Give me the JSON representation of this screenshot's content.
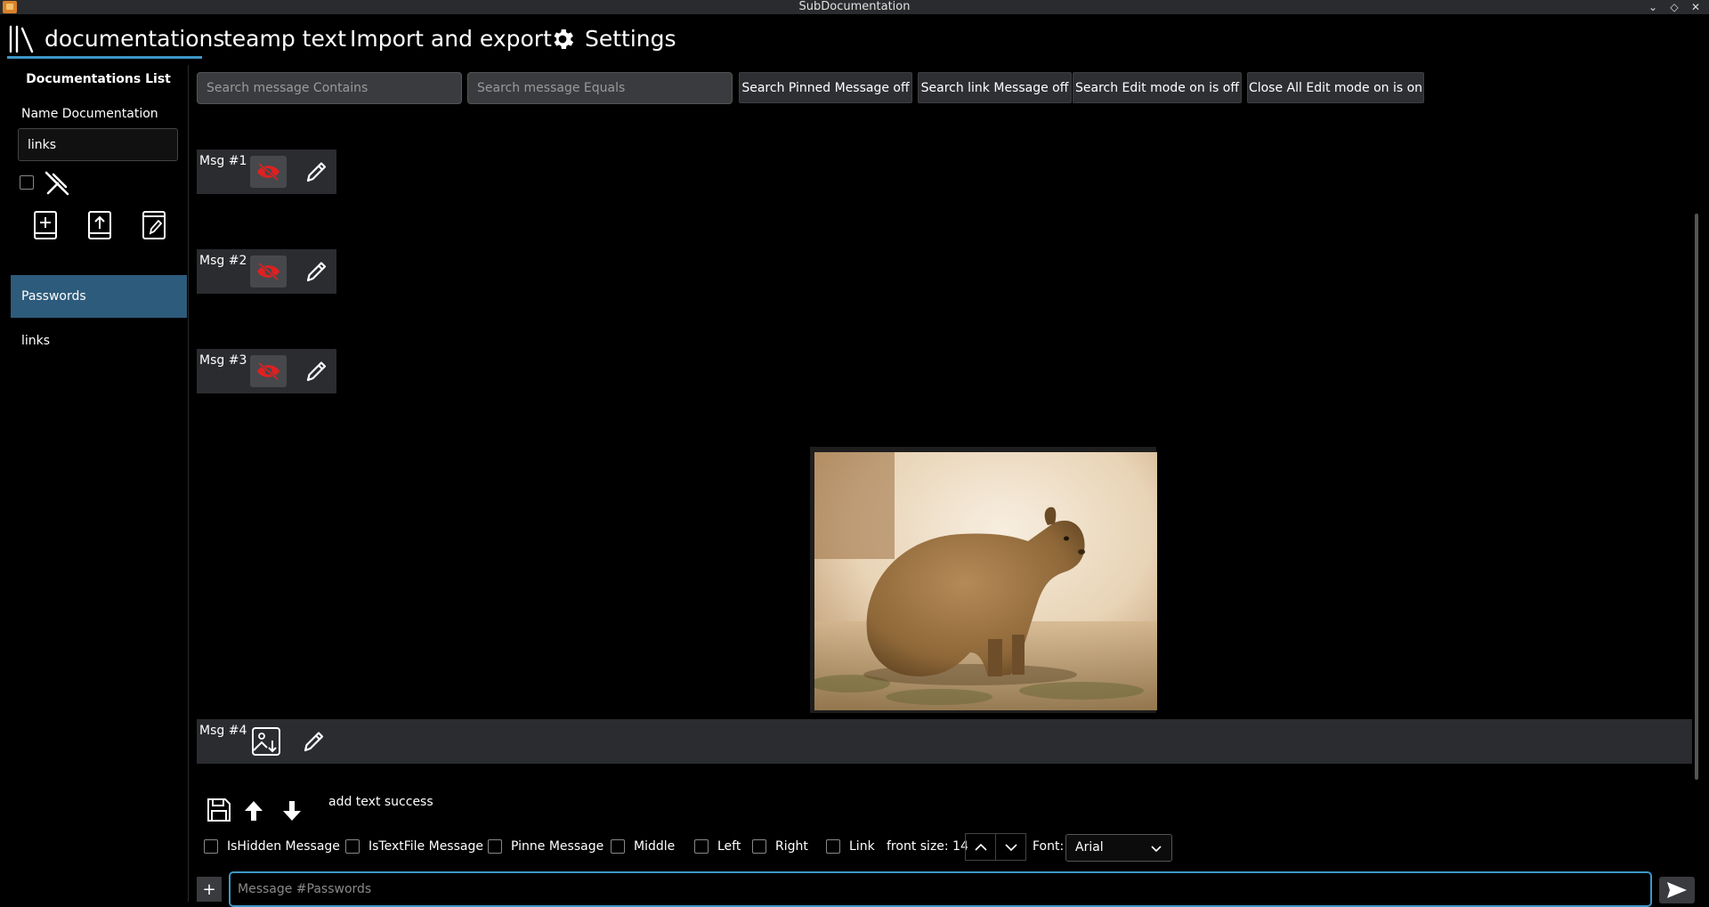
{
  "window": {
    "title": "SubDocumentation"
  },
  "nav": {
    "tabs": [
      {
        "label": "documentations"
      },
      {
        "label": "teamp text"
      },
      {
        "label": "Import and export"
      },
      {
        "label": "Settings"
      }
    ]
  },
  "sidebar": {
    "title": "Documentations List",
    "name_label": "Name Documentation",
    "name_value": "links",
    "items": [
      {
        "label": "Passwords",
        "selected": true
      },
      {
        "label": "links",
        "selected": false
      }
    ]
  },
  "search": {
    "contains_placeholder": "Search message Contains",
    "equals_placeholder": "Search message Equals",
    "pinned_label": "Search Pinned Message off",
    "link_label": "Search link Message off",
    "edit_mode_label": "Search Edit mode on is off",
    "close_all_label": "Close All Edit mode on is on"
  },
  "messages": [
    {
      "label": "Msg #1"
    },
    {
      "label": "Msg #2"
    },
    {
      "label": "Msg #3"
    },
    {
      "label": "Msg #4"
    }
  ],
  "toolbar": {
    "status": "add text success",
    "options": [
      {
        "label": "IsHidden Message",
        "checked": false
      },
      {
        "label": "IsTextFile Message",
        "checked": false
      },
      {
        "label": "Pinne Message",
        "checked": false
      },
      {
        "label": "Middle",
        "checked": false
      },
      {
        "label": "Left",
        "checked": false
      },
      {
        "label": "Right",
        "checked": false
      },
      {
        "label": "Link",
        "checked": false
      }
    ],
    "font_size_label": "front size: 14",
    "font_label": "Font:",
    "font_value": "Arial"
  },
  "composer": {
    "placeholder": "Message #Passwords",
    "add_label": "+"
  },
  "colors": {
    "accent": "#3d97c6",
    "selected_item": "#2d5b7b",
    "hide_icon": "#e02020"
  }
}
